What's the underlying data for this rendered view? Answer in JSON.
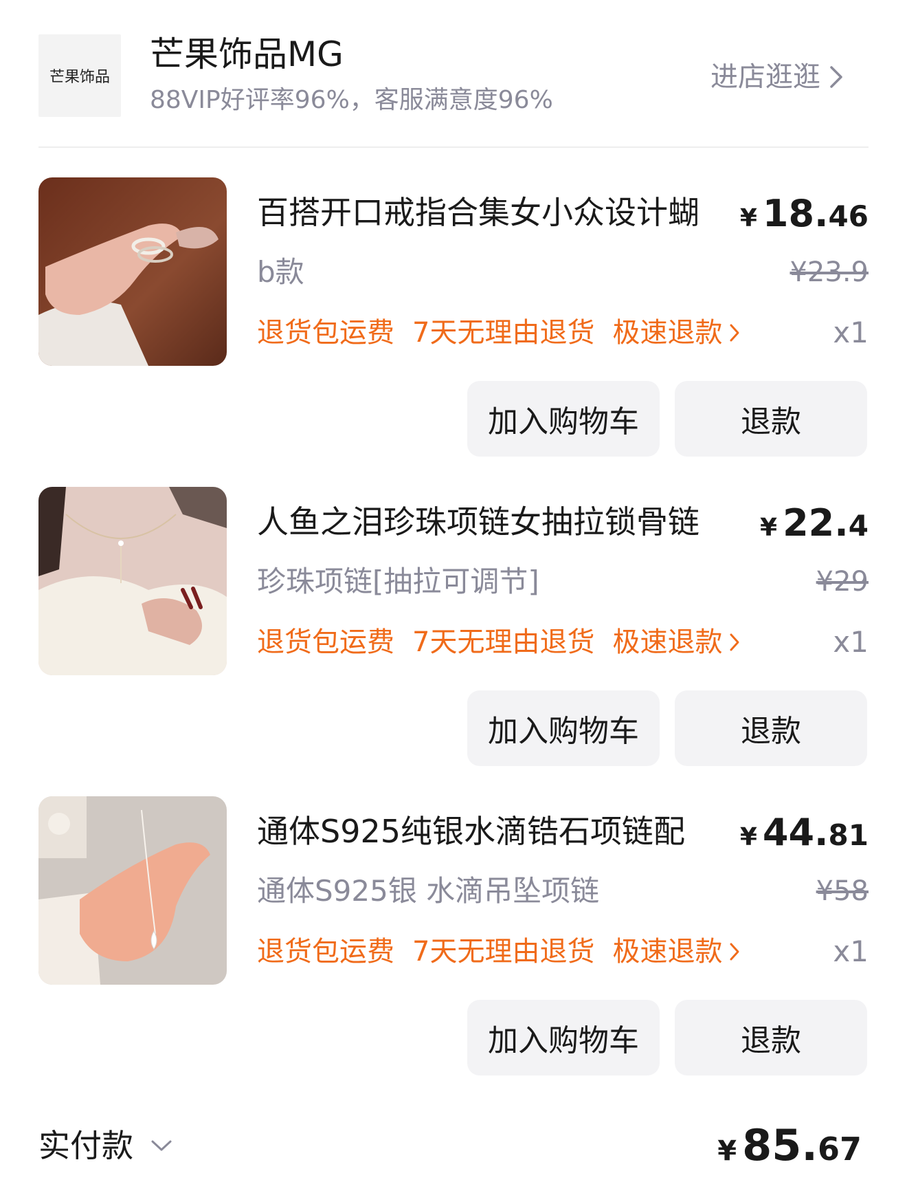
{
  "shop": {
    "logo_text": "芒果饰品",
    "name": "芒果饰品MG",
    "rating": "88VIP好评率96%，客服满意度96%",
    "enter_label": "进店逛逛"
  },
  "items": [
    {
      "title": "百搭开口戒指合集女小众设计蝴",
      "sku": "b款",
      "price_currency": "¥",
      "price_int": "18.",
      "price_dec": "46",
      "orig_price": "¥23.9",
      "tags": [
        "退货包运费",
        "7天无理由退货",
        "极速退款"
      ],
      "qty": "x1",
      "btn_cart": "加入购物车",
      "btn_refund": "退款"
    },
    {
      "title": "人鱼之泪珍珠项链女抽拉锁骨链",
      "sku": "珍珠项链[抽拉可调节]",
      "price_currency": "¥",
      "price_int": "22.",
      "price_dec": "4",
      "orig_price": "¥29",
      "tags": [
        "退货包运费",
        "7天无理由退货",
        "极速退款"
      ],
      "qty": "x1",
      "btn_cart": "加入购物车",
      "btn_refund": "退款"
    },
    {
      "title": "通体S925纯银水滴锆石项链配",
      "sku": "通体S925银 水滴吊坠项链",
      "price_currency": "¥",
      "price_int": "44.",
      "price_dec": "81",
      "orig_price": "¥58",
      "tags": [
        "退货包运费",
        "7天无理由退货",
        "极速退款"
      ],
      "qty": "x1",
      "btn_cart": "加入购物车",
      "btn_refund": "退款"
    }
  ],
  "footer": {
    "pay_label": "实付款",
    "total_currency": "¥",
    "total_int": "85.",
    "total_dec": "67"
  },
  "colors": {
    "accent_orange": "#f06b1a",
    "muted_text": "#8a8a99",
    "button_bg": "#f3f3f5"
  },
  "icons": {
    "enter_shop": "chevron-right-icon",
    "fast_refund": "chevron-right-icon",
    "pay_expand": "chevron-down-icon"
  }
}
